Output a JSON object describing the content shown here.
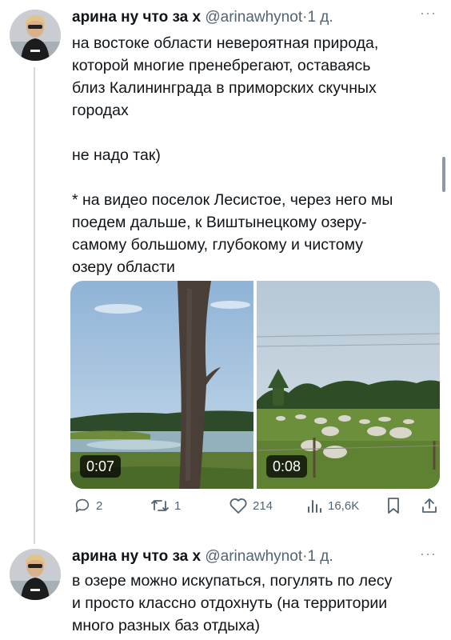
{
  "tweets": [
    {
      "author_name": "арина ну что за х",
      "handle": "@arinawhynot",
      "separator": "·",
      "time": "1 д.",
      "more": "···",
      "text_lines": [
        "на востоке области невероятная природа,",
        "которой многие пренебрегают, оставаясь",
        "близ Калининграда в приморских скучных",
        "городах",
        "",
        "не надо так)",
        "",
        "* на видео поселок Лесистое, через него мы",
        "поедем дальше, к Виштынецкому озеру-",
        "самому большому, глубокому и чистому",
        "озеру области"
      ],
      "media": [
        {
          "duration": "0:07",
          "scene": "lake-with-tree"
        },
        {
          "duration": "0:08",
          "scene": "field-with-sheep"
        }
      ],
      "actions": {
        "replies": "2",
        "retweets": "1",
        "likes": "214",
        "views": "16,6K"
      }
    },
    {
      "author_name": "арина ну что за х",
      "handle": "@arinawhynot",
      "separator": "·",
      "time": "1 д.",
      "more": "···",
      "text_lines": [
        "в озере можно искупаться, погулять по лесу",
        "и просто классно отдохнуть (на территории",
        "много разных баз отдыха)"
      ]
    }
  ],
  "icons": [
    "reply-icon",
    "retweet-icon",
    "like-icon",
    "views-icon",
    "bookmark-icon",
    "share-icon",
    "more-icon"
  ],
  "colors": {
    "text": "#0f1419",
    "secondary": "#536471",
    "thread_line": "#cfd9de"
  }
}
